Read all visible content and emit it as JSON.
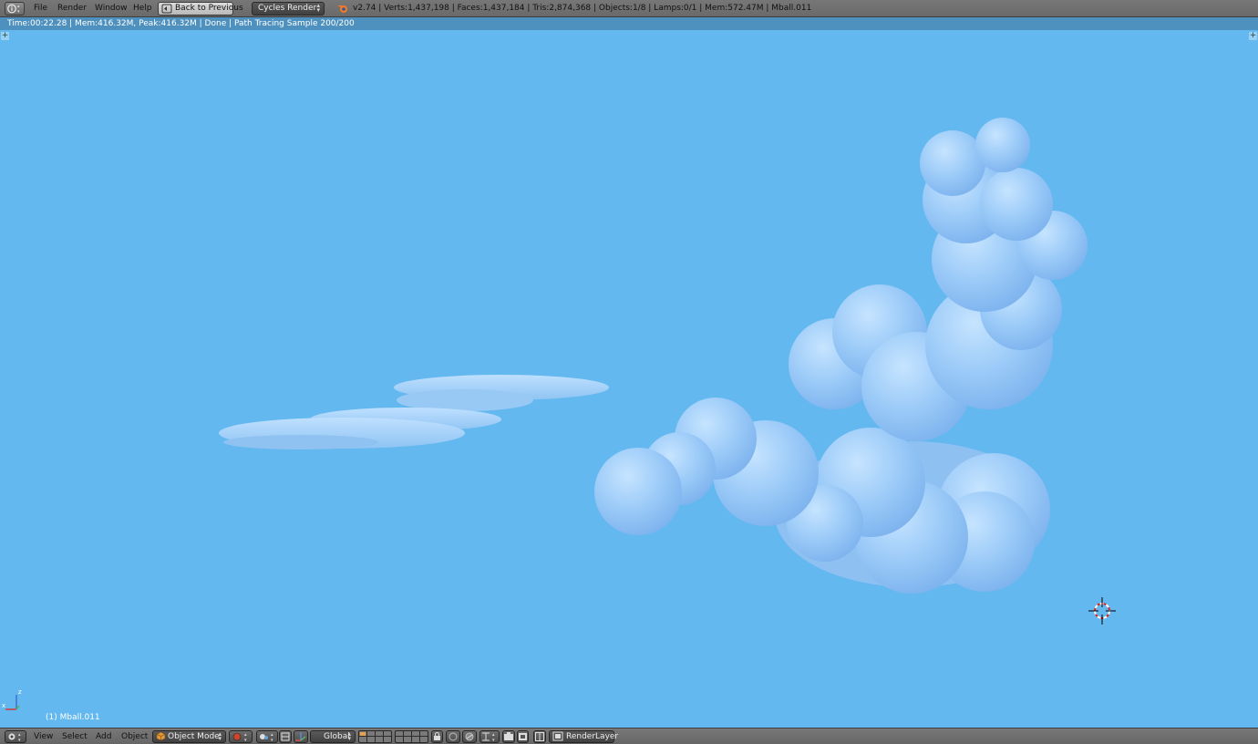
{
  "top_header": {
    "menus": [
      "File",
      "Render",
      "Window",
      "Help"
    ],
    "back_button": "Back to Previous",
    "render_engine": "Cycles Render",
    "stats": "v2.74 | Verts:1,437,198 | Faces:1,437,184 | Tris:2,874,368 | Objects:1/8 | Lamps:0/1 | Mem:572.47M | Mball.011"
  },
  "viewport": {
    "render_info": "Time:00:22.28 | Mem:416.32M, Peak:416.32M | Done | Path Tracing Sample 200/200",
    "object_label": "(1) Mball.011",
    "axis_labels": {
      "z": "z",
      "x": "x"
    },
    "background_color": "#63b8ef",
    "cloud_color": "#9fd0fb"
  },
  "bottom_header": {
    "menus": [
      "View",
      "Select",
      "Add",
      "Object"
    ],
    "mode": "Object Mode",
    "orientation": "Global",
    "render_layer": "RenderLayer"
  },
  "icons": [
    "info-editor-icon",
    "blender-logo-icon",
    "back-arrow-icon",
    "view3d-editor-icon",
    "cube-mode-icon",
    "shading-sphere-icon",
    "pivot-icon",
    "manipulator-icon",
    "layers-grid-icon",
    "lock-icon",
    "snap-magnet-icon",
    "camera-render-icon",
    "render-layer-icon"
  ]
}
